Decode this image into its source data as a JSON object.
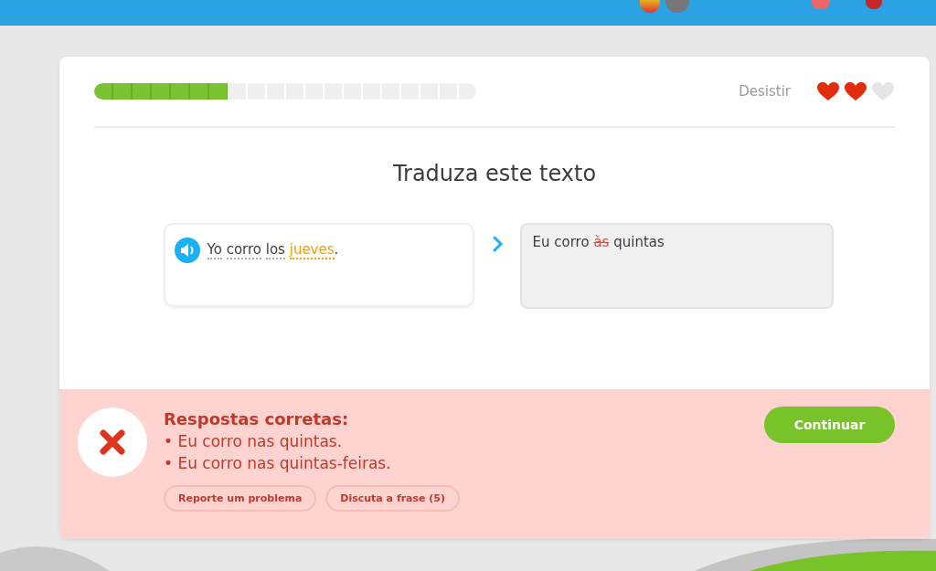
{
  "progress": {
    "level": 0.35
  },
  "quit_link": "Desistir",
  "hearts": [
    {
      "filled": true
    },
    {
      "filled": true
    },
    {
      "filled": false
    }
  ],
  "title": "Traduza este texto",
  "source": {
    "tokens": [
      {
        "text": "Yo",
        "kind": "word"
      },
      {
        "text": "corro",
        "kind": "word"
      },
      {
        "text": "los",
        "kind": "word"
      },
      {
        "text": "jueves",
        "kind": "highlight"
      },
      {
        "text": ".",
        "kind": "punct"
      }
    ]
  },
  "answer": {
    "tokens": [
      {
        "text": "Eu corro",
        "kind": "plain"
      },
      {
        "text": "às",
        "kind": "wrong"
      },
      {
        "text": "quintas",
        "kind": "plain"
      }
    ]
  },
  "feedback": {
    "title": "Respostas corretas:",
    "answers": [
      "• Eu corro nas quintas.",
      "• Eu corro nas quintas-feiras."
    ],
    "buttons": [
      "Reporte um problema",
      "Discuta a frase (5)"
    ]
  },
  "continue_button": "Continuar"
}
